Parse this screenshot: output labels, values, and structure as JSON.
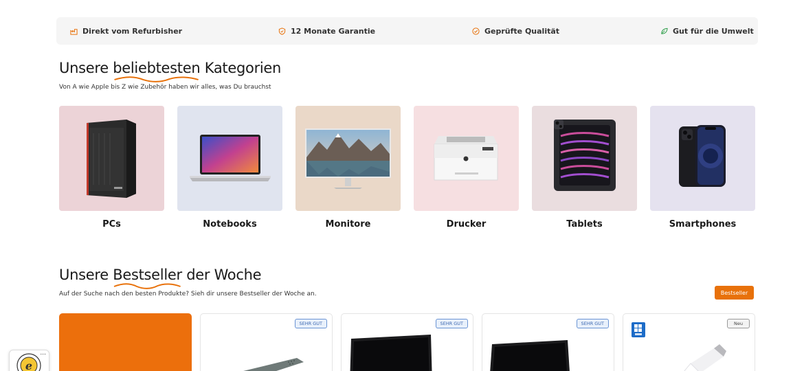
{
  "usp_bar": {
    "items": [
      {
        "label": "Direkt vom Refurbisher",
        "icon": "factory-icon"
      },
      {
        "label": "12 Monate Garantie",
        "icon": "shield-icon"
      },
      {
        "label": "Geprüfte Qualität",
        "icon": "check-circle-icon"
      },
      {
        "label": "Gut für die Umwelt",
        "icon": "leaf-icon"
      }
    ],
    "accent": "#e8710a",
    "eco_color": "#2e9e4a"
  },
  "categories_section": {
    "title_before": "Unsere",
    "title_highlight": "beliebtesten",
    "title_after": "Kategorien",
    "subtitle": "Von A wie Apple bis Z wie Zubehör haben wir alles, was Du brauchst",
    "items": [
      {
        "label": "PCs",
        "bg": "#ecd3d7",
        "icon": "desktop-tower-image"
      },
      {
        "label": "Notebooks",
        "bg": "#e0e4ef",
        "icon": "laptop-image"
      },
      {
        "label": "Monitore",
        "bg": "#ead8c8",
        "icon": "monitor-image"
      },
      {
        "label": "Drucker",
        "bg": "#f6dfe1",
        "icon": "printer-image"
      },
      {
        "label": "Tablets",
        "bg": "#eadddf",
        "icon": "tablet-image"
      },
      {
        "label": "Smartphones",
        "bg": "#e5e2ef",
        "icon": "smartphone-image"
      }
    ]
  },
  "bestseller_section": {
    "title_before": "Unsere",
    "title_highlight": "Bestseller",
    "title_after": "der Woche",
    "subtitle": "Auf der Suche nach den besten Produkte? Sieh dir unsere Bestseller der Woche an.",
    "button_label": "Bestseller",
    "products": [
      {
        "badge": "",
        "type": "promo"
      },
      {
        "badge": "SEHR GUT",
        "type": "thin-client"
      },
      {
        "badge": "SEHR GUT",
        "type": "laptop"
      },
      {
        "badge": "SEHR GUT",
        "type": "laptop"
      },
      {
        "badge": "Neu",
        "type": "usb-stick"
      }
    ]
  },
  "trust_widget": {
    "more_label": "...",
    "icon": "trusted-shops-seal-icon"
  }
}
